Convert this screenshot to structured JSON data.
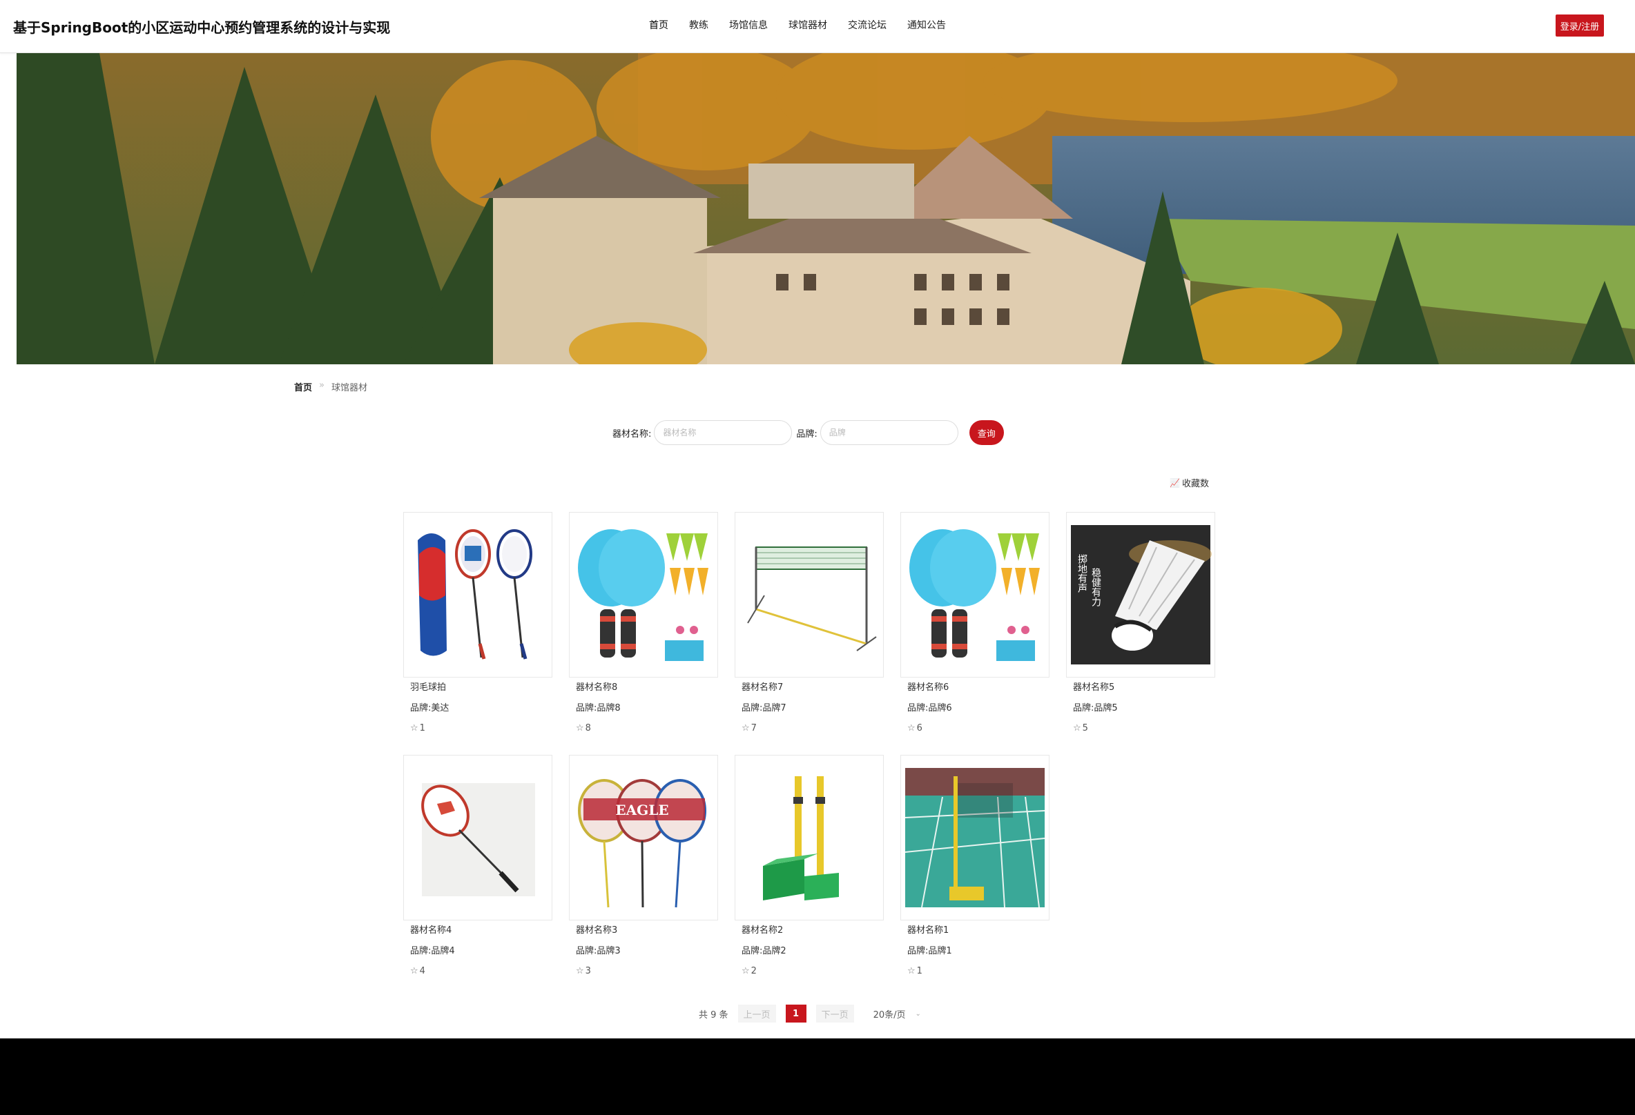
{
  "header": {
    "title": "基于SpringBoot的小区运动中心预约管理系统的设计与实现",
    "nav": [
      "首页",
      "教练",
      "场馆信息",
      "球馆器材",
      "交流论坛",
      "通知公告"
    ],
    "login_label": "登录/注册",
    "accent": "#c8161d"
  },
  "breadcrumb": {
    "home": "首页",
    "separator": "»",
    "current": "球馆器材"
  },
  "search": {
    "name_label": "器材名称:",
    "name_placeholder": "器材名称",
    "brand_label": "品牌:",
    "brand_placeholder": "品牌",
    "query_label": "查询"
  },
  "sort": {
    "icon": "bar-chart-icon",
    "label": "收藏数"
  },
  "items": [
    {
      "name": "羽毛球拍",
      "brand": "品牌:美达",
      "fav": "1",
      "image": "badminton-racket-set"
    },
    {
      "name": "器材名称8",
      "brand": "品牌:品牌8",
      "fav": "8",
      "image": "beach-paddle-set"
    },
    {
      "name": "器材名称7",
      "brand": "品牌:品牌7",
      "fav": "7",
      "image": "badminton-net"
    },
    {
      "name": "器材名称6",
      "brand": "品牌:品牌6",
      "fav": "6",
      "image": "beach-paddle-set"
    },
    {
      "name": "器材名称5",
      "brand": "品牌:品牌5",
      "fav": "5",
      "image": "shuttlecock"
    },
    {
      "name": "器材名称4",
      "brand": "品牌:品牌4",
      "fav": "4",
      "image": "single-racket"
    },
    {
      "name": "器材名称3",
      "brand": "品牌:品牌3",
      "fav": "3",
      "image": "eagle-rackets"
    },
    {
      "name": "器材名称2",
      "brand": "品牌:品牌2",
      "fav": "2",
      "image": "net-posts"
    },
    {
      "name": "器材名称1",
      "brand": "品牌:品牌1",
      "fav": "1",
      "image": "badminton-court"
    }
  ],
  "shuttle_text": [
    "掷地有声",
    "稳健有力"
  ],
  "racket_brand_text": "EAGLE",
  "pagination": {
    "total": "共 9 条",
    "prev": "上一页",
    "current": "1",
    "next": "下一页",
    "page_size": "20条/页"
  }
}
